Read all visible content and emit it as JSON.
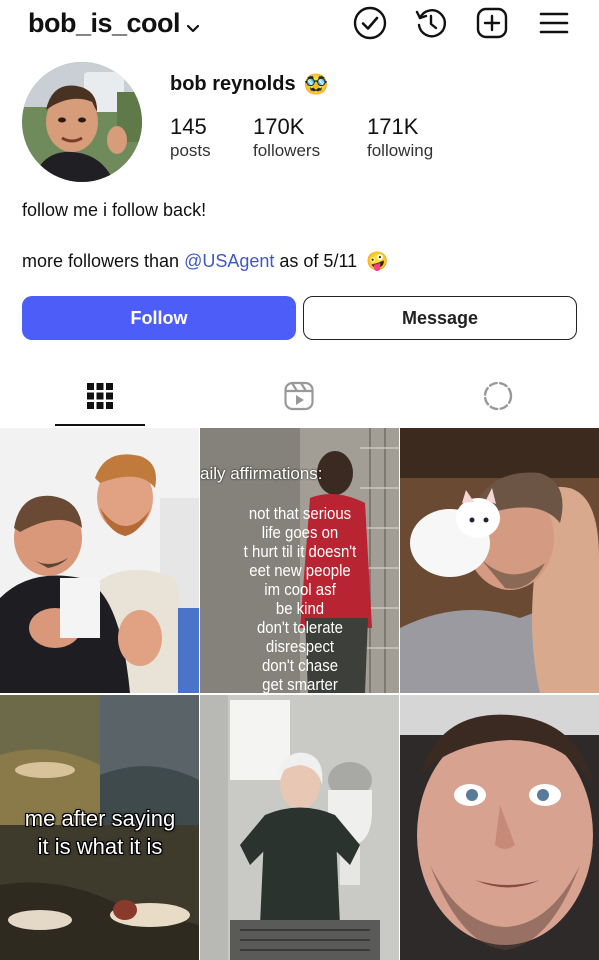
{
  "header": {
    "username": "bob_is_cool",
    "icons": [
      "check-circle-icon",
      "history-icon",
      "new-post-icon",
      "menu-icon"
    ]
  },
  "profile": {
    "full_name": "bob reynolds",
    "name_emoji": "🥸",
    "stats": [
      {
        "value": "145",
        "label": "posts"
      },
      {
        "value": "170K",
        "label": "followers"
      },
      {
        "value": "171K",
        "label": "following"
      }
    ],
    "bio_line1": "follow me i follow back!",
    "bio_line2_prefix": "more followers than ",
    "bio_mention": "@USAgent",
    "bio_line2_suffix": " as of 5/11",
    "bio_emoji": "🤪"
  },
  "actions": {
    "follow_label": "Follow",
    "message_label": "Message"
  },
  "tabs": [
    "grid-icon",
    "reels-icon",
    "tagged-icon"
  ],
  "posts": {
    "affirmations_title": "aily affirmations:",
    "affirmations": [
      "not that serious",
      "life goes on",
      "t hurt til it doesn't",
      "eet new people",
      "im cool asf",
      "be kind",
      "don't tolerate",
      "disrespect",
      "don't chase",
      "get smarter"
    ],
    "meme_line1": "me after saying",
    "meme_line2": "it is what it is"
  },
  "colors": {
    "follow_button": "#4d5ef8",
    "mention_link": "#3f58c9"
  }
}
